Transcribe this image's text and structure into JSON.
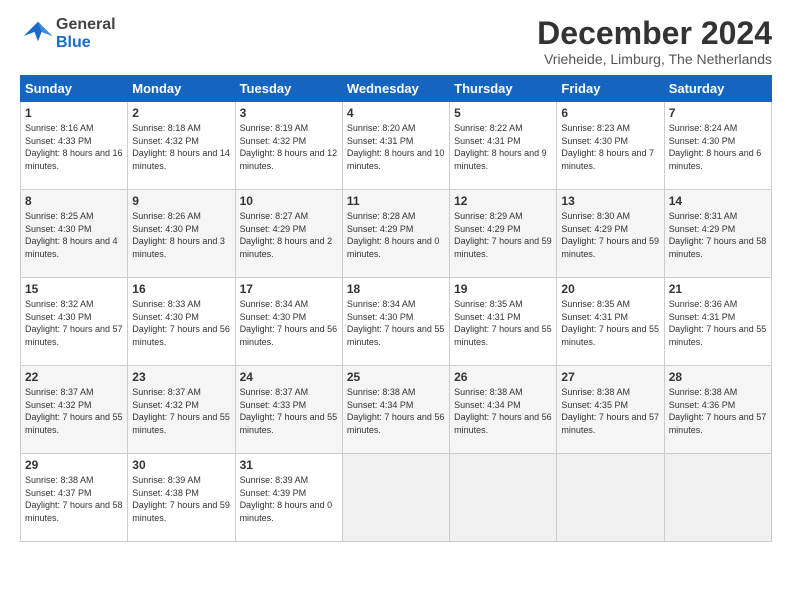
{
  "header": {
    "logo_general": "General",
    "logo_blue": "Blue",
    "month_title": "December 2024",
    "location": "Vrieheide, Limburg, The Netherlands"
  },
  "days_of_week": [
    "Sunday",
    "Monday",
    "Tuesday",
    "Wednesday",
    "Thursday",
    "Friday",
    "Saturday"
  ],
  "weeks": [
    [
      {
        "day": "1",
        "sunrise": "Sunrise: 8:16 AM",
        "sunset": "Sunset: 4:33 PM",
        "daylight": "Daylight: 8 hours and 16 minutes."
      },
      {
        "day": "2",
        "sunrise": "Sunrise: 8:18 AM",
        "sunset": "Sunset: 4:32 PM",
        "daylight": "Daylight: 8 hours and 14 minutes."
      },
      {
        "day": "3",
        "sunrise": "Sunrise: 8:19 AM",
        "sunset": "Sunset: 4:32 PM",
        "daylight": "Daylight: 8 hours and 12 minutes."
      },
      {
        "day": "4",
        "sunrise": "Sunrise: 8:20 AM",
        "sunset": "Sunset: 4:31 PM",
        "daylight": "Daylight: 8 hours and 10 minutes."
      },
      {
        "day": "5",
        "sunrise": "Sunrise: 8:22 AM",
        "sunset": "Sunset: 4:31 PM",
        "daylight": "Daylight: 8 hours and 9 minutes."
      },
      {
        "day": "6",
        "sunrise": "Sunrise: 8:23 AM",
        "sunset": "Sunset: 4:30 PM",
        "daylight": "Daylight: 8 hours and 7 minutes."
      },
      {
        "day": "7",
        "sunrise": "Sunrise: 8:24 AM",
        "sunset": "Sunset: 4:30 PM",
        "daylight": "Daylight: 8 hours and 6 minutes."
      }
    ],
    [
      {
        "day": "8",
        "sunrise": "Sunrise: 8:25 AM",
        "sunset": "Sunset: 4:30 PM",
        "daylight": "Daylight: 8 hours and 4 minutes."
      },
      {
        "day": "9",
        "sunrise": "Sunrise: 8:26 AM",
        "sunset": "Sunset: 4:30 PM",
        "daylight": "Daylight: 8 hours and 3 minutes."
      },
      {
        "day": "10",
        "sunrise": "Sunrise: 8:27 AM",
        "sunset": "Sunset: 4:29 PM",
        "daylight": "Daylight: 8 hours and 2 minutes."
      },
      {
        "day": "11",
        "sunrise": "Sunrise: 8:28 AM",
        "sunset": "Sunset: 4:29 PM",
        "daylight": "Daylight: 8 hours and 0 minutes."
      },
      {
        "day": "12",
        "sunrise": "Sunrise: 8:29 AM",
        "sunset": "Sunset: 4:29 PM",
        "daylight": "Daylight: 7 hours and 59 minutes."
      },
      {
        "day": "13",
        "sunrise": "Sunrise: 8:30 AM",
        "sunset": "Sunset: 4:29 PM",
        "daylight": "Daylight: 7 hours and 59 minutes."
      },
      {
        "day": "14",
        "sunrise": "Sunrise: 8:31 AM",
        "sunset": "Sunset: 4:29 PM",
        "daylight": "Daylight: 7 hours and 58 minutes."
      }
    ],
    [
      {
        "day": "15",
        "sunrise": "Sunrise: 8:32 AM",
        "sunset": "Sunset: 4:30 PM",
        "daylight": "Daylight: 7 hours and 57 minutes."
      },
      {
        "day": "16",
        "sunrise": "Sunrise: 8:33 AM",
        "sunset": "Sunset: 4:30 PM",
        "daylight": "Daylight: 7 hours and 56 minutes."
      },
      {
        "day": "17",
        "sunrise": "Sunrise: 8:34 AM",
        "sunset": "Sunset: 4:30 PM",
        "daylight": "Daylight: 7 hours and 56 minutes."
      },
      {
        "day": "18",
        "sunrise": "Sunrise: 8:34 AM",
        "sunset": "Sunset: 4:30 PM",
        "daylight": "Daylight: 7 hours and 55 minutes."
      },
      {
        "day": "19",
        "sunrise": "Sunrise: 8:35 AM",
        "sunset": "Sunset: 4:31 PM",
        "daylight": "Daylight: 7 hours and 55 minutes."
      },
      {
        "day": "20",
        "sunrise": "Sunrise: 8:35 AM",
        "sunset": "Sunset: 4:31 PM",
        "daylight": "Daylight: 7 hours and 55 minutes."
      },
      {
        "day": "21",
        "sunrise": "Sunrise: 8:36 AM",
        "sunset": "Sunset: 4:31 PM",
        "daylight": "Daylight: 7 hours and 55 minutes."
      }
    ],
    [
      {
        "day": "22",
        "sunrise": "Sunrise: 8:37 AM",
        "sunset": "Sunset: 4:32 PM",
        "daylight": "Daylight: 7 hours and 55 minutes."
      },
      {
        "day": "23",
        "sunrise": "Sunrise: 8:37 AM",
        "sunset": "Sunset: 4:32 PM",
        "daylight": "Daylight: 7 hours and 55 minutes."
      },
      {
        "day": "24",
        "sunrise": "Sunrise: 8:37 AM",
        "sunset": "Sunset: 4:33 PM",
        "daylight": "Daylight: 7 hours and 55 minutes."
      },
      {
        "day": "25",
        "sunrise": "Sunrise: 8:38 AM",
        "sunset": "Sunset: 4:34 PM",
        "daylight": "Daylight: 7 hours and 56 minutes."
      },
      {
        "day": "26",
        "sunrise": "Sunrise: 8:38 AM",
        "sunset": "Sunset: 4:34 PM",
        "daylight": "Daylight: 7 hours and 56 minutes."
      },
      {
        "day": "27",
        "sunrise": "Sunrise: 8:38 AM",
        "sunset": "Sunset: 4:35 PM",
        "daylight": "Daylight: 7 hours and 57 minutes."
      },
      {
        "day": "28",
        "sunrise": "Sunrise: 8:38 AM",
        "sunset": "Sunset: 4:36 PM",
        "daylight": "Daylight: 7 hours and 57 minutes."
      }
    ],
    [
      {
        "day": "29",
        "sunrise": "Sunrise: 8:38 AM",
        "sunset": "Sunset: 4:37 PM",
        "daylight": "Daylight: 7 hours and 58 minutes."
      },
      {
        "day": "30",
        "sunrise": "Sunrise: 8:39 AM",
        "sunset": "Sunset: 4:38 PM",
        "daylight": "Daylight: 7 hours and 59 minutes."
      },
      {
        "day": "31",
        "sunrise": "Sunrise: 8:39 AM",
        "sunset": "Sunset: 4:39 PM",
        "daylight": "Daylight: 8 hours and 0 minutes."
      },
      null,
      null,
      null,
      null
    ]
  ]
}
